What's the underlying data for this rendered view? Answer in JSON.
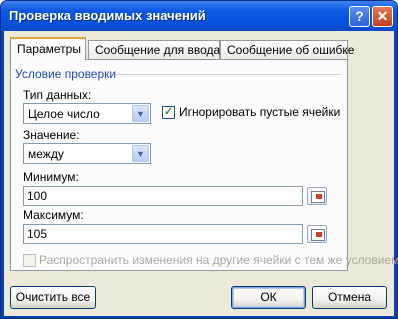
{
  "window": {
    "title": "Проверка вводимых значений",
    "help_glyph": "?",
    "close_glyph": "✕"
  },
  "tabs": [
    {
      "label": "Параметры",
      "active": true
    },
    {
      "label": "Сообщение для ввода",
      "active": false
    },
    {
      "label": "Сообщение об ошибке",
      "active": false
    }
  ],
  "condition": {
    "group_label": "Условие проверки",
    "data_type_label": "Тип данных:",
    "data_type_value": "Целое число",
    "ignore_blank_label": "Игнорировать пустые ячейки",
    "ignore_blank_checked": true,
    "value_label": "Значение:",
    "value_value": "между",
    "min_label": "Минимум:",
    "min_value": "100",
    "max_label": "Максимум:",
    "max_value": "105"
  },
  "apply_all": {
    "label": "Распространить изменения на другие ячейки с тем же условием",
    "checked": false,
    "enabled": false
  },
  "buttons": {
    "clear_all": "Очистить все",
    "ok": "ОК",
    "cancel": "Отмена"
  },
  "icons": {
    "dropdown": "chevron-down-icon",
    "range_select": "range-select-icon",
    "check": "checkmark-icon"
  },
  "colors": {
    "title_bar": "#0651db",
    "client_bg": "#ece9d8",
    "group_label": "#1a48b8",
    "active_tab_accent": "#e6a235"
  }
}
